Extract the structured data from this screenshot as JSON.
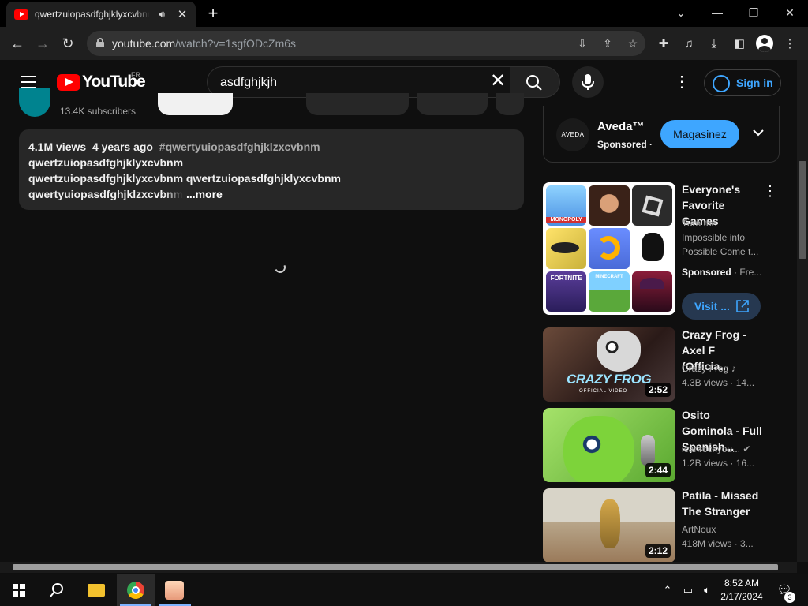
{
  "browser": {
    "tab_title": "qwertzuiopasdfghjklyxcvbnm",
    "url_domain": "youtube.com",
    "url_path": "/watch?v=1sgfODcZm6s"
  },
  "header": {
    "logo_text": "YouTube",
    "country_code": "FR",
    "search_value": "asdfghjkjh",
    "signin_label": "Sign in"
  },
  "channel": {
    "subscribers": "13.4K subscribers"
  },
  "description": {
    "views": "4.1M views",
    "age": "4 years ago",
    "hashtag": "#qwertyuiopasdfghjklzxcvbnm",
    "line1": "qwertzuiopasdfghjklyxcvbnm",
    "line2": "qwertzuiopasdfghjklyxcvbnm qwertzuiopasdfghjklyxcvbnm",
    "line3": "qwertyuiopasdfghjklzxcvbnm",
    "more_label": "...more"
  },
  "ad": {
    "brand": "Aveda™",
    "logo_text": "AVEDA",
    "sponsored": "Sponsored ·",
    "cta": "Magasinez"
  },
  "games_ad": {
    "title": "Everyone's Favorite Games",
    "description": "Turn the Impossible into Possible Come t...",
    "sponsored": "Sponsored",
    "extra": " · Fre...",
    "visit_label": "Visit ...",
    "tiles": [
      "MONOPOLY",
      "",
      "",
      "",
      "",
      "",
      "FORTNITE",
      "MINECRAFT",
      ""
    ]
  },
  "videos": [
    {
      "title": "Crazy Frog - Axel F (Officia...",
      "channel": "Crazy Frog",
      "meta": "4.3B views · 14...",
      "duration": "2:52",
      "thumb_text": "CRAZY FROG",
      "thumb_sub": "OFFICIAL VIDEO"
    },
    {
      "title": "Osito Gominola - Full Spanish...",
      "channel": "icanrockyou...",
      "meta": "1.2B views · 16...",
      "duration": "2:44"
    },
    {
      "title": "Patila - Missed The Stranger",
      "channel": "ArtNoux",
      "meta": "418M views · 3...",
      "duration": "2:12"
    }
  ],
  "taskbar": {
    "time": "8:52 AM",
    "date": "2/17/2024",
    "notifications": "3"
  },
  "colors": {
    "accent": "#3ea6ff",
    "brand_red": "#ff0000",
    "background": "#0f0f0f"
  }
}
